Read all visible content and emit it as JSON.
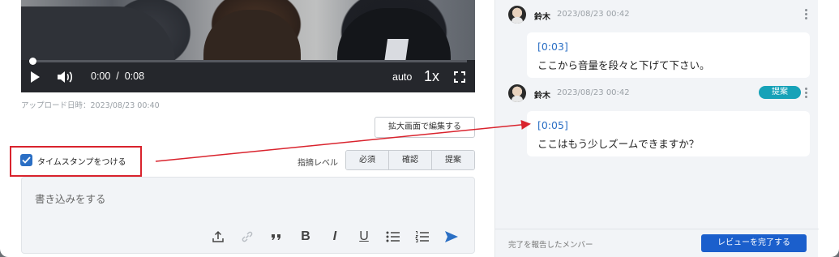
{
  "video": {
    "current_time": "0:00",
    "separator": "/",
    "duration": "0:08",
    "quality": "auto",
    "speed": "1x",
    "progress_fraction": 0.0
  },
  "upload_meta": "アップロード日時：2023/08/23 00:40",
  "expand_button": "拡大画面で編集する",
  "timestamp_checkbox": {
    "label": "タイムスタンプをつける",
    "checked": true
  },
  "level": {
    "label": "指摘レベル",
    "options": [
      "必須",
      "確認",
      "提案"
    ]
  },
  "composer": {
    "placeholder": "書き込みをする",
    "toolbar": [
      "upload-icon",
      "link-icon",
      "quote-icon",
      "bold-icon",
      "italic-icon",
      "underline-icon",
      "bulleted-list-icon",
      "numbered-list-icon",
      "send-icon"
    ]
  },
  "comments": [
    {
      "author": "鈴木",
      "date": "2023/08/23 00:42",
      "timestamp": "[0:03]",
      "text": "ここから音量を段々と下げて下さい。",
      "badge": ""
    },
    {
      "author": "鈴木",
      "date": "2023/08/23 00:42",
      "timestamp": "[0:05]",
      "text": "ここはもう少しズームできますか？",
      "badge": "提案"
    }
  ],
  "footer": {
    "members_label": "完了を報告したメンバー",
    "complete_button": "レビューを完了する"
  },
  "colors": {
    "accent": "#2b6fc4",
    "primary_button": "#1b5fcc",
    "badge": "#17a2b8",
    "highlight": "#d9232d"
  }
}
